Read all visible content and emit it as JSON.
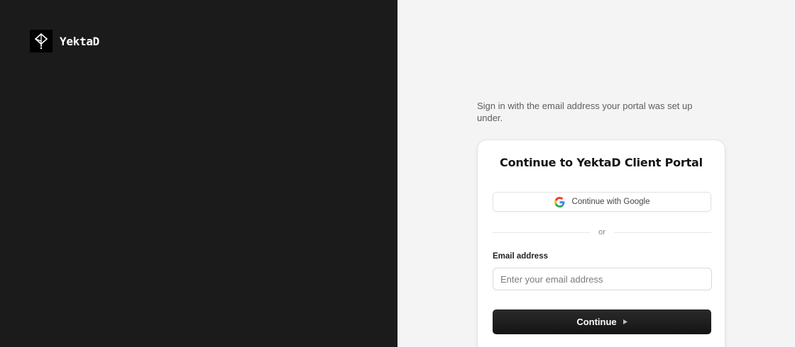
{
  "brand": {
    "name": "YektaD"
  },
  "intro": {
    "text": "Sign in with the email address your portal was set up under."
  },
  "card": {
    "title": "Continue to YektaD Client Portal",
    "google_label": "Continue with Google",
    "divider_text": "or",
    "email_label": "Email address",
    "email_placeholder": "Enter your email address",
    "email_value": "",
    "continue_label": "Continue"
  },
  "icons": {
    "brand": "diamond-pin-icon",
    "google": "google-icon",
    "continue": "play-arrow-icon"
  },
  "colors": {
    "left_panel": "#1b1b1b",
    "right_panel": "#f4f4f4",
    "primary_button": "#1b1b1b",
    "google_blue": "#4285F4",
    "google_red": "#EA4335",
    "google_yellow": "#FBBC05",
    "google_green": "#34A853"
  }
}
